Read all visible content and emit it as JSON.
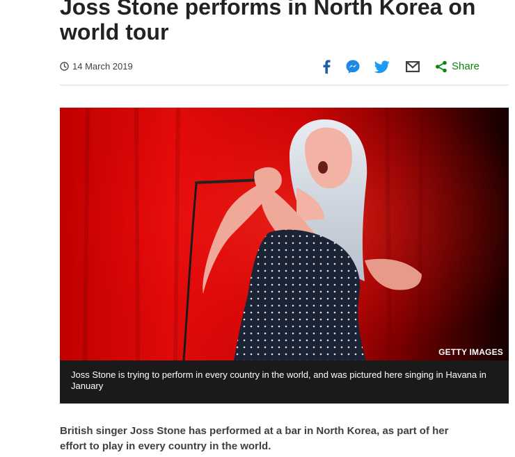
{
  "article": {
    "headline": "Joss Stone performs in North Korea on world tour",
    "date": "14 March 2019",
    "share": {
      "label": "Share",
      "colors": {
        "facebook": "#1f5ea8",
        "messenger": "#1e88e5",
        "twitter": "#1d9bf0",
        "email": "#404040",
        "share": "#0e8513"
      }
    },
    "image": {
      "credit": "GETTY IMAGES",
      "caption": "Joss Stone is trying to perform in every country in the world, and was pictured here singing in Havana in January"
    },
    "intro": "British singer Joss Stone has performed at a bar in North Korea, as part of her effort to play in every country in the world."
  }
}
